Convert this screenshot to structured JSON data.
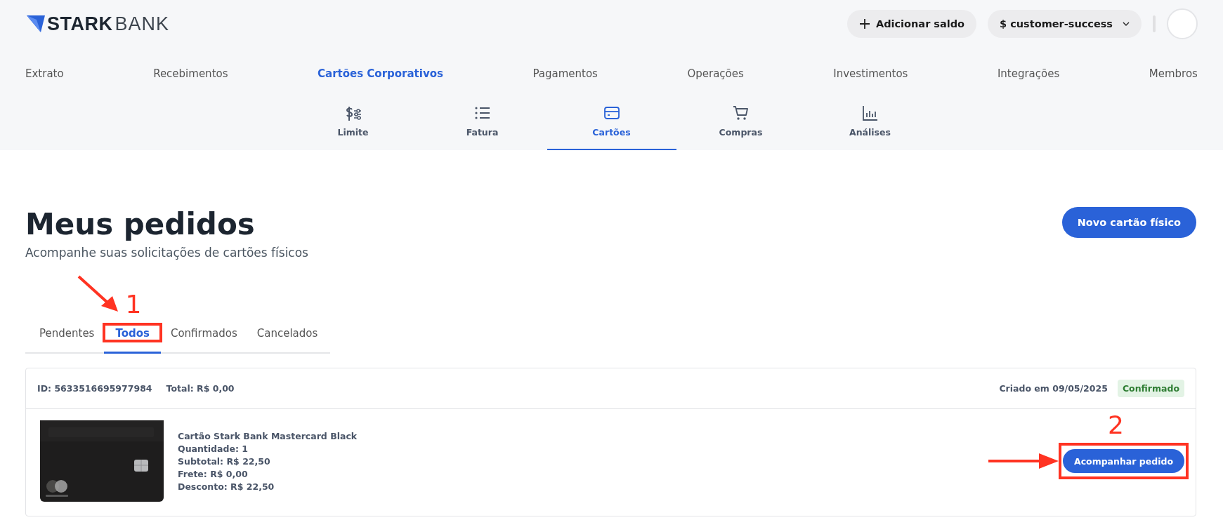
{
  "header": {
    "logo": {
      "strong": "STARK",
      "light": "BANK"
    },
    "add_balance_button": "Adicionar saldo",
    "account_button": "$ customer-success"
  },
  "main_nav": [
    {
      "label": "Extrato",
      "selected": false
    },
    {
      "label": "Recebimentos",
      "selected": false
    },
    {
      "label": "Cartões Corporativos",
      "selected": true
    },
    {
      "label": "Pagamentos",
      "selected": false
    },
    {
      "label": "Operações",
      "selected": false
    },
    {
      "label": "Investimentos",
      "selected": false
    },
    {
      "label": "Integrações",
      "selected": false
    },
    {
      "label": "Membros",
      "selected": false
    }
  ],
  "sub_nav": [
    {
      "label": "Limite",
      "kind": "limit",
      "selected": false
    },
    {
      "label": "Fatura",
      "kind": "list",
      "selected": false
    },
    {
      "label": "Cartões",
      "kind": "card",
      "selected": true
    },
    {
      "label": "Compras",
      "kind": "cart",
      "selected": false
    },
    {
      "label": "Análises",
      "kind": "chart",
      "selected": false
    }
  ],
  "page": {
    "title": "Meus pedidos",
    "subtitle": "Acompanhe suas solicitações de cartões físicos",
    "new_card_button": "Novo cartão físico"
  },
  "tabs": [
    {
      "label": "Pendentes",
      "selected": false
    },
    {
      "label": "Todos",
      "selected": true,
      "callout": "1"
    },
    {
      "label": "Confirmados",
      "selected": false
    },
    {
      "label": "Cancelados",
      "selected": false
    }
  ],
  "orders": [
    {
      "id": "ID: 5633516695977984",
      "total": "Total: R$ 0,00",
      "created": "Criado em 09/05/2025",
      "status": "Confirmado",
      "product": {
        "kind": "picture",
        "lines": [
          "Cartão Stark Bank Mastercard Black",
          "Quantidade: 1",
          "Subtotal: R$ 22,50",
          "Frete: R$ 0,00",
          "Desconto: R$ 22,50"
        ]
      },
      "track_button": "Acompanhar pedido",
      "callout": "2"
    }
  ]
}
